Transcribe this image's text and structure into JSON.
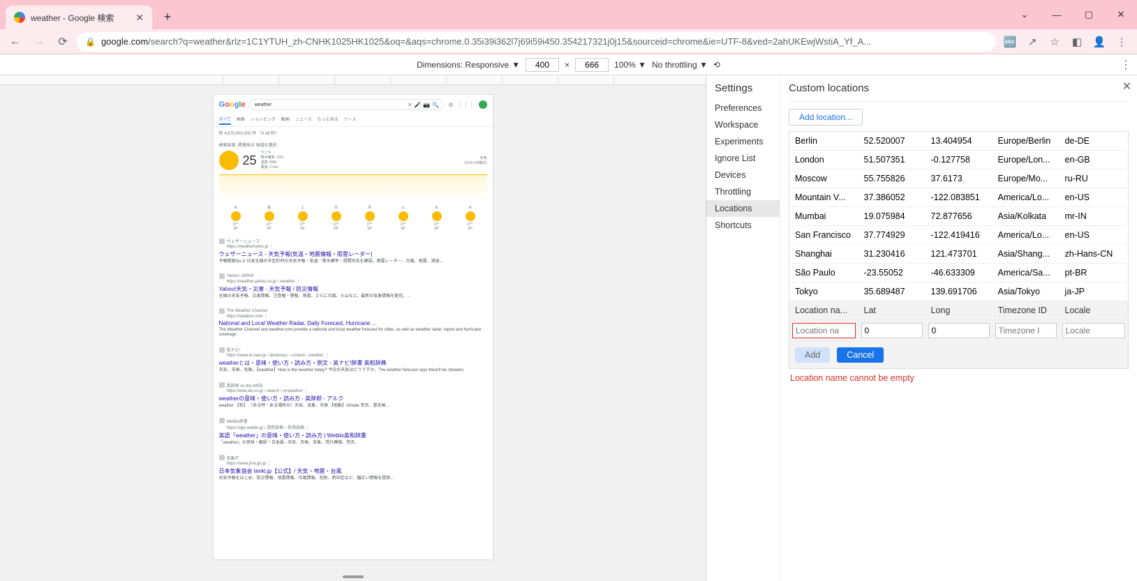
{
  "browser": {
    "tab_title": "weather - Google 検索",
    "url_domain": "google.com",
    "url_path": "/search?q=weather&rlz=1C1YTUH_zh-CNHK1025HK1025&oq=&aqs=chrome.0.35i39i362l7j69i59i450.354217321j0j15&sourceid=chrome&ie=UTF-8&ved=2ahUKEwjWstiA_Yf_A..."
  },
  "devtoolbar": {
    "dim_label": "Dimensions: Responsive",
    "w": "400",
    "h": "666",
    "zoom": "100%",
    "throttle": "No throttling"
  },
  "gsearch": {
    "query": "weather",
    "tabs": [
      "すべて",
      "画像",
      "ショッピング",
      "動画",
      "ニュース",
      "もっと見る",
      "ツール"
    ],
    "stats": "約 4,870,000,000 件 （0.38 秒）",
    "wlabel": "検索結果: 関連地点 地域を選択 :",
    "temp": "25",
    "unit": "°C | °F",
    "det1": "降水確率: 15%",
    "det2": "湿度: 84%",
    "det3": "風速: 2 m/s",
    "wr1": "天気",
    "wr2": "12:00 (木曜日)",
    "days": [
      "木",
      "金",
      "土",
      "日",
      "月",
      "火",
      "水",
      "木"
    ]
  },
  "results": [
    {
      "src": "ウェザーニュース",
      "url": "https://weathernews.jp",
      "title": "ウェザーニュース - 天気予報(気温・地震情報・雨雲レーダー)",
      "desc": "予報精度No.1! 日本全国の市区町村の天気予報・気温・降水確率・週間天気を確認。雨雲レーダー、台風、地震、津波..."
    },
    {
      "src": "Yahoo! JAPAN",
      "url": "https://weather.yahoo.co.jp › weather",
      "title": "Yahoo!天気・災害 - 天気予報 / 防災情報",
      "desc": "全国の天気予報、災害情報、注意報・警報、地震、さらに台風、火山など。最新の気象情報を配信。..."
    },
    {
      "src": "The Weather Channel",
      "url": "https://weather.com",
      "title": "National and Local Weather Radar, Daily Forecast, Hurricane ...",
      "desc": "The Weather Channel and weather.com provide a national and local weather forecast for cities, as well as weather radar, report and hurricane coverage."
    },
    {
      "src": "英ナビ!",
      "url": "https://www.ei-navi.jp › dictionary › content › weather",
      "title": "weatherとは・意味・使い方・読み方・例文 - 英ナビ!辞書 英和辞典",
      "desc": "天気、天候、気象。【weather】How is the weather today? 今日の天気はどうですか。The weather forecast says there'll be showers."
    },
    {
      "src": "英辞郎 on the WEB",
      "url": "https://eow.alc.co.jp › search › q=weather",
      "title": "weatherの意味・使い方・読み方 - 英辞郎 - アルク",
      "desc": "weather 【名】 〔ある時・ある場所の〕天気、気象、天候 【他動】climate 荒天、悪天候..."
    },
    {
      "src": "Weblio辞書",
      "url": "https://ejje.weblio.jp › 英和辞典・和英辞典",
      "title": "英語「weather」の意味・使い方・読み方 | Weblio英和辞書",
      "desc": "「weather」の意味・翻訳・日本語 - 天気、天候、気象、荒れ模様、荒天..."
    },
    {
      "src": "気象庁",
      "url": "https://www.jma.go.jp",
      "title": "日本気象協会 tenki.jp【公式】/ 天気・地震・台風",
      "desc": "天気予報をはじめ、防災情報、地震情報、台風情報、花粉、熱中症など、幅広い情報を提供..."
    }
  ],
  "settings": {
    "title": "Settings",
    "panel_title": "Custom locations",
    "items": [
      "Preferences",
      "Workspace",
      "Experiments",
      "Ignore List",
      "Devices",
      "Throttling",
      "Locations",
      "Shortcuts"
    ],
    "selected": "Locations",
    "add_location": "Add location...",
    "headers": {
      "name": "Location na...",
      "lat": "Lat",
      "long": "Long",
      "tz": "Timezone ID",
      "locale": "Locale"
    },
    "rows": [
      {
        "name": "Berlin",
        "lat": "52.520007",
        "long": "13.404954",
        "tz": "Europe/Berlin",
        "locale": "de-DE"
      },
      {
        "name": "London",
        "lat": "51.507351",
        "long": "-0.127758",
        "tz": "Europe/Lon...",
        "locale": "en-GB"
      },
      {
        "name": "Moscow",
        "lat": "55.755826",
        "long": "37.6173",
        "tz": "Europe/Mo...",
        "locale": "ru-RU"
      },
      {
        "name": "Mountain V...",
        "lat": "37.386052",
        "long": "-122.083851",
        "tz": "America/Lo...",
        "locale": "en-US"
      },
      {
        "name": "Mumbai",
        "lat": "19.075984",
        "long": "72.877656",
        "tz": "Asia/Kolkata",
        "locale": "mr-IN"
      },
      {
        "name": "San Francisco",
        "lat": "37.774929",
        "long": "-122.419416",
        "tz": "America/Lo...",
        "locale": "en-US"
      },
      {
        "name": "Shanghai",
        "lat": "31.230416",
        "long": "121.473701",
        "tz": "Asia/Shang...",
        "locale": "zh-Hans-CN"
      },
      {
        "name": "São Paulo",
        "lat": "-23.55052",
        "long": "-46.633309",
        "tz": "America/Sa...",
        "locale": "pt-BR"
      },
      {
        "name": "Tokyo",
        "lat": "35.689487",
        "long": "139.691706",
        "tz": "Asia/Tokyo",
        "locale": "ja-JP"
      }
    ],
    "input": {
      "name_ph": "Location na",
      "lat": "0",
      "long": "0",
      "tz_ph": "Timezone I",
      "locale_ph": "Locale"
    },
    "add_btn": "Add",
    "cancel_btn": "Cancel",
    "error": "Location name cannot be empty"
  }
}
